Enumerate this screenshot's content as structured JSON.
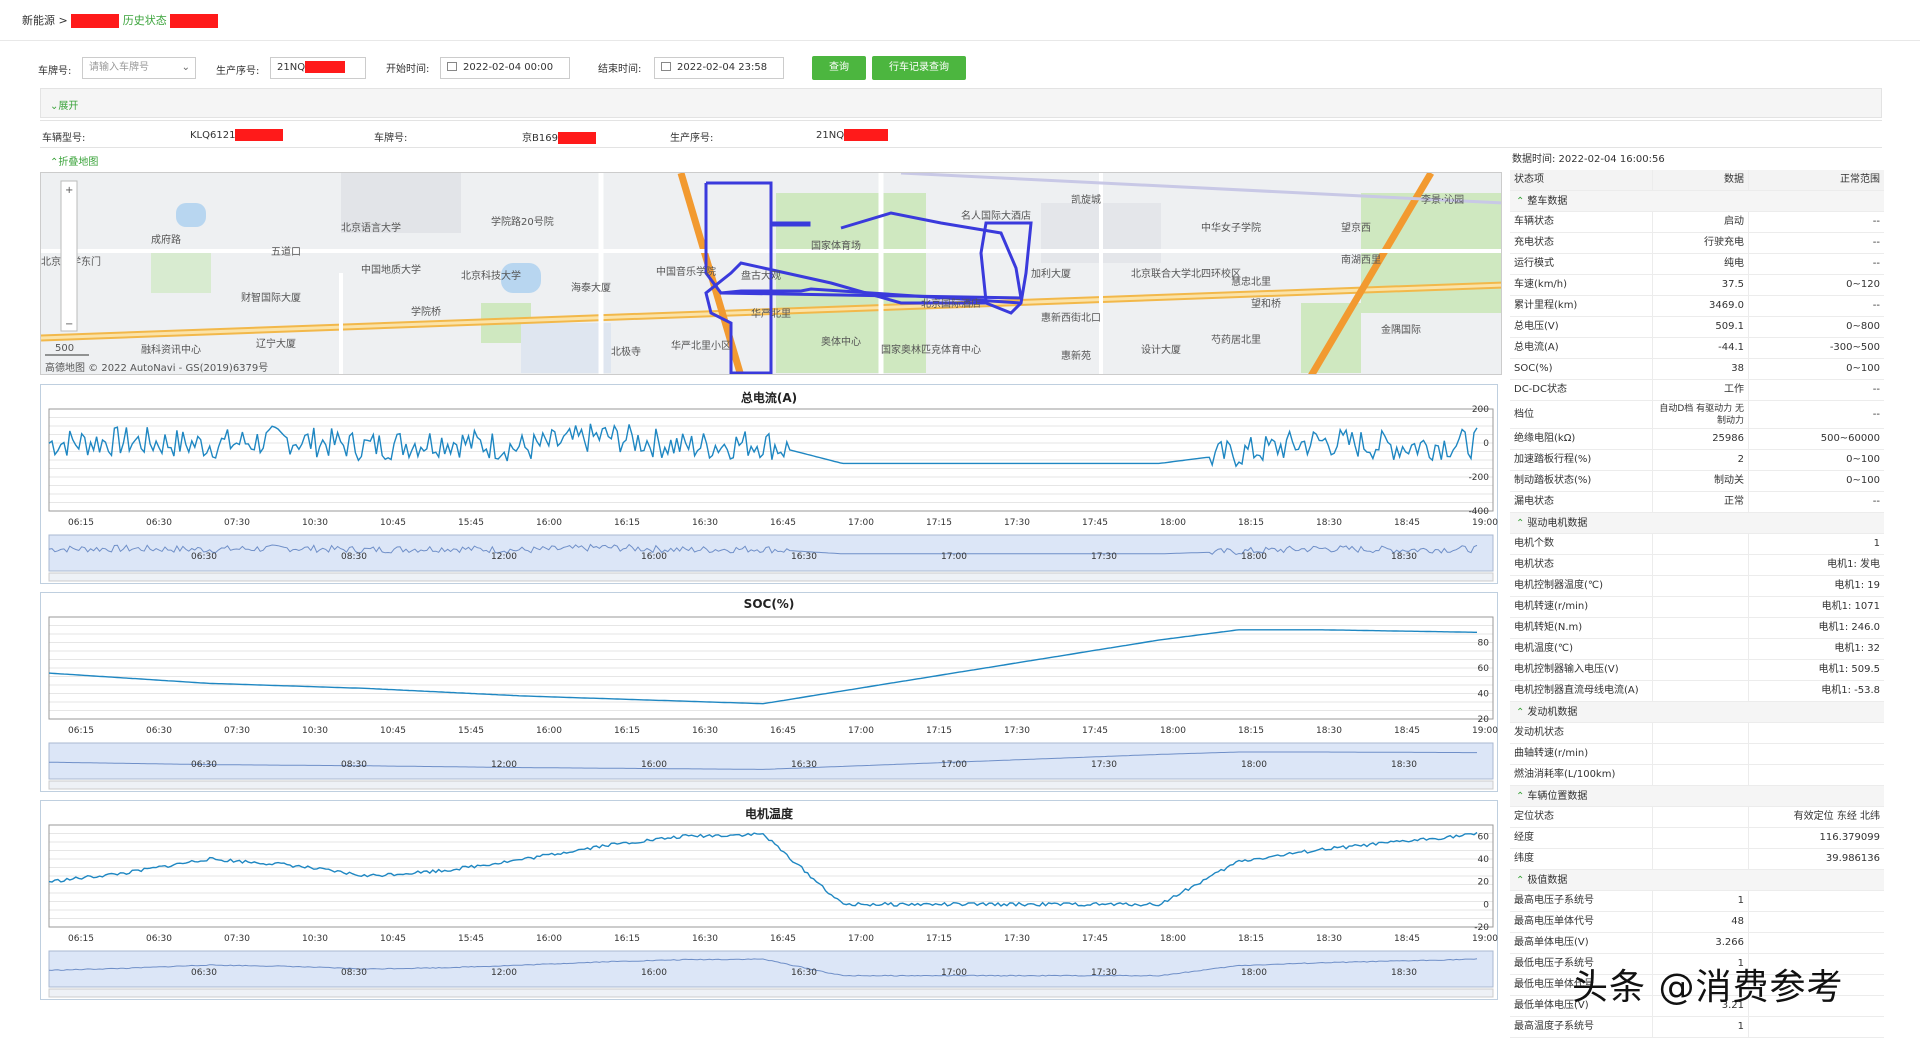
{
  "breadcrumb": {
    "root": "新能源",
    "sep": ">",
    "page": "历史状态"
  },
  "filters": {
    "plate_label": "车牌号:",
    "plate_placeholder": "请输入车牌号",
    "serial_label": "生产序号:",
    "serial_value": "21NQ",
    "start_label": "开始时间:",
    "start_value": "2022-02-04 00:00",
    "end_label": "结束时间:",
    "end_value": "2022-02-04 23:58",
    "query_btn": "查询",
    "trip_btn": "行车记录查询"
  },
  "expand_label": "展开",
  "vehicle_info": {
    "model_label": "车辆型号:",
    "model_value": "KLQ6121",
    "plate_label": "车牌号:",
    "plate_value": "京B169",
    "serial_label": "生产序号:",
    "serial_value": "21NQ"
  },
  "collapse_map_label": "折叠地图",
  "map": {
    "labels": [
      "北京语言大学",
      "学院路20号院",
      "中国音乐学院",
      "国家体育场",
      "名人国际大酒店",
      "凯旋城",
      "中华女子学院",
      "望京西",
      "李景·沁园",
      "成府路",
      "五道口",
      "北京大学东门",
      "中国地质大学",
      "北京科技大学",
      "海泰大厦",
      "盘古大观",
      "加利大厦",
      "北京联合大学北四环校区",
      "慧忠北里",
      "南湖西里",
      "财智国际大厦",
      "学院桥",
      "华严北里",
      "北京国际酒店",
      "惠新西街北口",
      "望和桥",
      "辽宁大厦",
      "融科资讯中心",
      "北极寺",
      "华严北里小区",
      "奥体中心",
      "国家奥林匹克体育中心",
      "设计大厦",
      "惠新苑",
      "芍药居北里",
      "金隅国际"
    ],
    "scale": "500",
    "copyright": "高德地图 © 2022 AutoNavi - GS(2019)6379号"
  },
  "time_ticks": [
    "06:15",
    "06:30",
    "07:30",
    "10:30",
    "10:45",
    "15:45",
    "16:00",
    "16:15",
    "16:30",
    "16:45",
    "17:00",
    "17:15",
    "17:30",
    "17:45",
    "18:00",
    "18:15",
    "18:30",
    "18:45",
    "19:00"
  ],
  "nav_ticks": [
    "06:30",
    "08:30",
    "12:00",
    "16:00",
    "16:30",
    "17:00",
    "17:30",
    "18:00",
    "18:30"
  ],
  "charts": [
    {
      "title": "总电流(A)",
      "yticks": [
        "200",
        "0",
        "-200",
        "-400"
      ],
      "ylim": [
        -400,
        200
      ]
    },
    {
      "title": "SOC(%)",
      "yticks": [
        "80",
        "60",
        "40",
        "20"
      ],
      "ylim": [
        20,
        100
      ]
    },
    {
      "title": "电机温度",
      "yticks": [
        "60",
        "40",
        "20",
        "0",
        "-20"
      ],
      "ylim": [
        -20,
        70
      ]
    }
  ],
  "chart_data": [
    {
      "type": "line",
      "title": "总电流(A)",
      "categories": [
        "06:15",
        "06:30",
        "07:30",
        "10:30",
        "10:45",
        "15:45",
        "16:00",
        "16:15",
        "16:30",
        "16:45",
        "17:00",
        "17:15",
        "17:30",
        "17:45",
        "18:00",
        "18:15",
        "18:30",
        "18:45",
        "19:00"
      ],
      "series": [
        {
          "values": [
            0,
            10,
            -10,
            20,
            -20,
            10,
            -30,
            40,
            -20,
            0,
            -120,
            -120,
            -120,
            -120,
            -120,
            -60,
            10,
            -20,
            0
          ]
        }
      ],
      "ylim": [
        -400,
        200
      ]
    },
    {
      "type": "line",
      "title": "SOC(%)",
      "categories": [
        "06:15",
        "06:30",
        "07:30",
        "10:30",
        "10:45",
        "15:45",
        "16:00",
        "16:15",
        "16:30",
        "16:45",
        "17:00",
        "17:15",
        "17:30",
        "17:45",
        "18:00",
        "18:15",
        "18:30",
        "18:45",
        "19:00"
      ],
      "series": [
        {
          "values": [
            56,
            52,
            48,
            46,
            44,
            41,
            38,
            36,
            34,
            32,
            42,
            52,
            62,
            72,
            82,
            90,
            90,
            89,
            88
          ]
        }
      ],
      "ylim": [
        20,
        100
      ]
    },
    {
      "type": "line",
      "title": "电机温度",
      "categories": [
        "06:15",
        "06:30",
        "07:30",
        "10:30",
        "10:45",
        "15:45",
        "16:00",
        "16:15",
        "16:30",
        "16:45",
        "17:00",
        "17:15",
        "17:30",
        "17:45",
        "18:00",
        "18:15",
        "18:30",
        "18:45",
        "19:00"
      ],
      "series": [
        {
          "values": [
            20,
            28,
            40,
            35,
            25,
            30,
            40,
            52,
            60,
            62,
            0,
            0,
            0,
            0,
            0,
            38,
            48,
            55,
            62
          ]
        }
      ],
      "ylim": [
        -20,
        70
      ]
    }
  ],
  "status": {
    "data_time": "数据时间: 2022-02-04 16:00:56",
    "header": {
      "c1": "状态项",
      "c2": "数据",
      "c3": "正常范围"
    },
    "sections": [
      {
        "title": "整车数据",
        "rows": [
          [
            "车辆状态",
            "启动",
            "--"
          ],
          [
            "充电状态",
            "行驶充电",
            "--"
          ],
          [
            "运行模式",
            "纯电",
            "--"
          ],
          [
            "车速(km/h)",
            "37.5",
            "0~120"
          ],
          [
            "累计里程(km)",
            "3469.0",
            "--"
          ],
          [
            "总电压(V)",
            "509.1",
            "0~800"
          ],
          [
            "总电流(A)",
            "-44.1",
            "-300~500"
          ],
          [
            "SOC(%)",
            "38",
            "0~100"
          ],
          [
            "DC-DC状态",
            "工作",
            "--"
          ],
          [
            "档位",
            "自动D档 有驱动力 无制动力",
            "--"
          ],
          [
            "绝缘电阻(kΩ)",
            "25986",
            "500~60000"
          ],
          [
            "加速踏板行程(%)",
            "2",
            "0~100"
          ],
          [
            "制动踏板状态(%)",
            "制动关",
            "0~100"
          ],
          [
            "漏电状态",
            "正常",
            "--"
          ]
        ]
      },
      {
        "title": "驱动电机数据",
        "rows": [
          [
            "电机个数",
            "",
            "1"
          ],
          [
            "电机状态",
            "",
            "电机1: 发电"
          ],
          [
            "电机控制器温度(℃)",
            "",
            "电机1: 19"
          ],
          [
            "电机转速(r/min)",
            "",
            "电机1: 1071"
          ],
          [
            "电机转矩(N.m)",
            "",
            "电机1: 246.0"
          ],
          [
            "电机温度(℃)",
            "",
            "电机1: 32"
          ],
          [
            "电机控制器输入电压(V)",
            "",
            "电机1: 509.5"
          ],
          [
            "电机控制器直流母线电流(A)",
            "",
            "电机1: -53.8"
          ]
        ]
      },
      {
        "title": "发动机数据",
        "rows": [
          [
            "发动机状态",
            "",
            ""
          ],
          [
            "曲轴转速(r/min)",
            "",
            ""
          ],
          [
            "燃油消耗率(L/100km)",
            "",
            ""
          ]
        ]
      },
      {
        "title": "车辆位置数据",
        "rows": [
          [
            "定位状态",
            "",
            "有效定位 东经 北纬"
          ],
          [
            "经度",
            "",
            "116.379099"
          ],
          [
            "纬度",
            "",
            "39.986136"
          ]
        ]
      },
      {
        "title": "极值数据",
        "rows": [
          [
            "最高电压子系统号",
            "1",
            ""
          ],
          [
            "最高电压单体代号",
            "48",
            ""
          ],
          [
            "最高单体电压(V)",
            "3.266",
            ""
          ],
          [
            "最低电压子系统号",
            "1",
            ""
          ],
          [
            "最低电压单体代号",
            "",
            ""
          ],
          [
            "最低单体电压(V)",
            "3.21",
            ""
          ],
          [
            "最高温度子系统号",
            "1",
            ""
          ]
        ]
      }
    ]
  },
  "watermark": "头条 @消费参考"
}
